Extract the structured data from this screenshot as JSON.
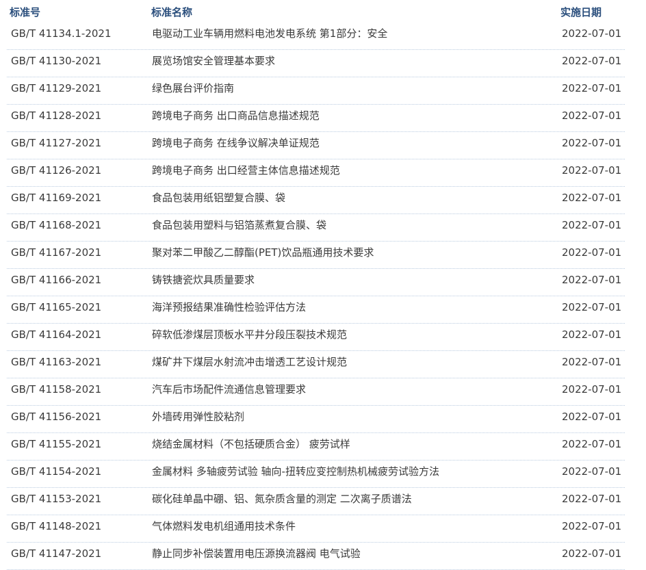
{
  "table": {
    "headers": {
      "code": "标准号",
      "name": "标准名称",
      "date": "实施日期"
    },
    "rows": [
      {
        "code": "GB/T 41134.1-2021",
        "name": "电驱动工业车辆用燃料电池发电系统 第1部分：安全",
        "date": "2022-07-01"
      },
      {
        "code": "GB/T 41130-2021",
        "name": "展览场馆安全管理基本要求",
        "date": "2022-07-01"
      },
      {
        "code": "GB/T 41129-2021",
        "name": "绿色展台评价指南",
        "date": "2022-07-01"
      },
      {
        "code": "GB/T 41128-2021",
        "name": "跨境电子商务 出口商品信息描述规范",
        "date": "2022-07-01"
      },
      {
        "code": "GB/T 41127-2021",
        "name": "跨境电子商务 在线争议解决单证规范",
        "date": "2022-07-01"
      },
      {
        "code": "GB/T 41126-2021",
        "name": "跨境电子商务 出口经营主体信息描述规范",
        "date": "2022-07-01"
      },
      {
        "code": "GB/T 41169-2021",
        "name": "食品包装用纸铝塑复合膜、袋",
        "date": "2022-07-01"
      },
      {
        "code": "GB/T 41168-2021",
        "name": "食品包装用塑料与铝箔蒸煮复合膜、袋",
        "date": "2022-07-01"
      },
      {
        "code": "GB/T 41167-2021",
        "name": "聚对苯二甲酸乙二醇酯(PET)饮品瓶通用技术要求",
        "date": "2022-07-01"
      },
      {
        "code": "GB/T 41166-2021",
        "name": "铸铁搪瓷炊具质量要求",
        "date": "2022-07-01"
      },
      {
        "code": "GB/T 41165-2021",
        "name": "海洋预报结果准确性检验评估方法",
        "date": "2022-07-01"
      },
      {
        "code": "GB/T 41164-2021",
        "name": "碎软低渗煤层顶板水平井分段压裂技术规范",
        "date": "2022-07-01"
      },
      {
        "code": "GB/T 41163-2021",
        "name": "煤矿井下煤层水射流冲击增透工艺设计规范",
        "date": "2022-07-01"
      },
      {
        "code": "GB/T 41158-2021",
        "name": "汽车后市场配件流通信息管理要求",
        "date": "2022-07-01"
      },
      {
        "code": "GB/T 41156-2021",
        "name": "外墙砖用弹性胶粘剂",
        "date": "2022-07-01"
      },
      {
        "code": "GB/T 41155-2021",
        "name": "烧结金属材料（不包括硬质合金） 疲劳试样",
        "date": "2022-07-01"
      },
      {
        "code": "GB/T 41154-2021",
        "name": "金属材料 多轴疲劳试验 轴向-扭转应变控制热机械疲劳试验方法",
        "date": "2022-07-01"
      },
      {
        "code": "GB/T 41153-2021",
        "name": "碳化硅单晶中硼、铝、氮杂质含量的测定 二次离子质谱法",
        "date": "2022-07-01"
      },
      {
        "code": "GB/T 41148-2021",
        "name": "气体燃料发电机组通用技术条件",
        "date": "2022-07-01"
      },
      {
        "code": "GB/T 41147-2021",
        "name": "静止同步补偿装置用电压源换流器阀 电气试验",
        "date": "2022-07-01"
      }
    ]
  }
}
